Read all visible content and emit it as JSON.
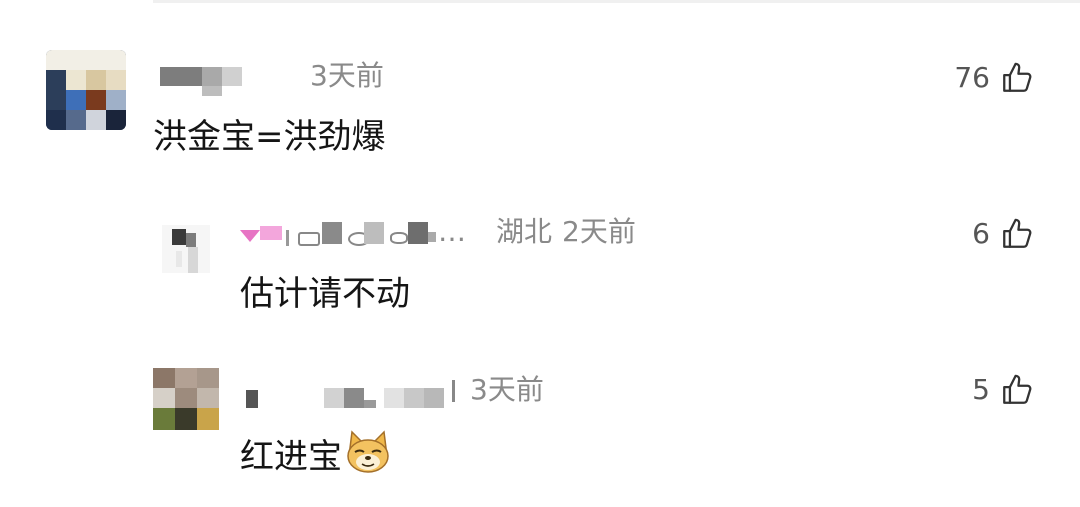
{
  "comments": [
    {
      "nickname_visible": "",
      "location": "",
      "time": "3天前",
      "text": "洪金宝=洪劲爆",
      "likes": "76",
      "like_icon": "thumbs-up-outline"
    },
    {
      "nickname_visible": "…",
      "location": "湖北",
      "time": "2天前",
      "text": "估计请不动",
      "likes": "6",
      "like_icon": "thumbs-up-outline"
    },
    {
      "nickname_visible": "",
      "location": "",
      "time": "3天前",
      "text": "红进宝",
      "emoji": "doge-face",
      "likes": "5",
      "like_icon": "thumbs-up-outline"
    }
  ],
  "colors": {
    "meta_gray": "#8a8a8a",
    "text": "#151515",
    "like_gray": "#555555"
  }
}
